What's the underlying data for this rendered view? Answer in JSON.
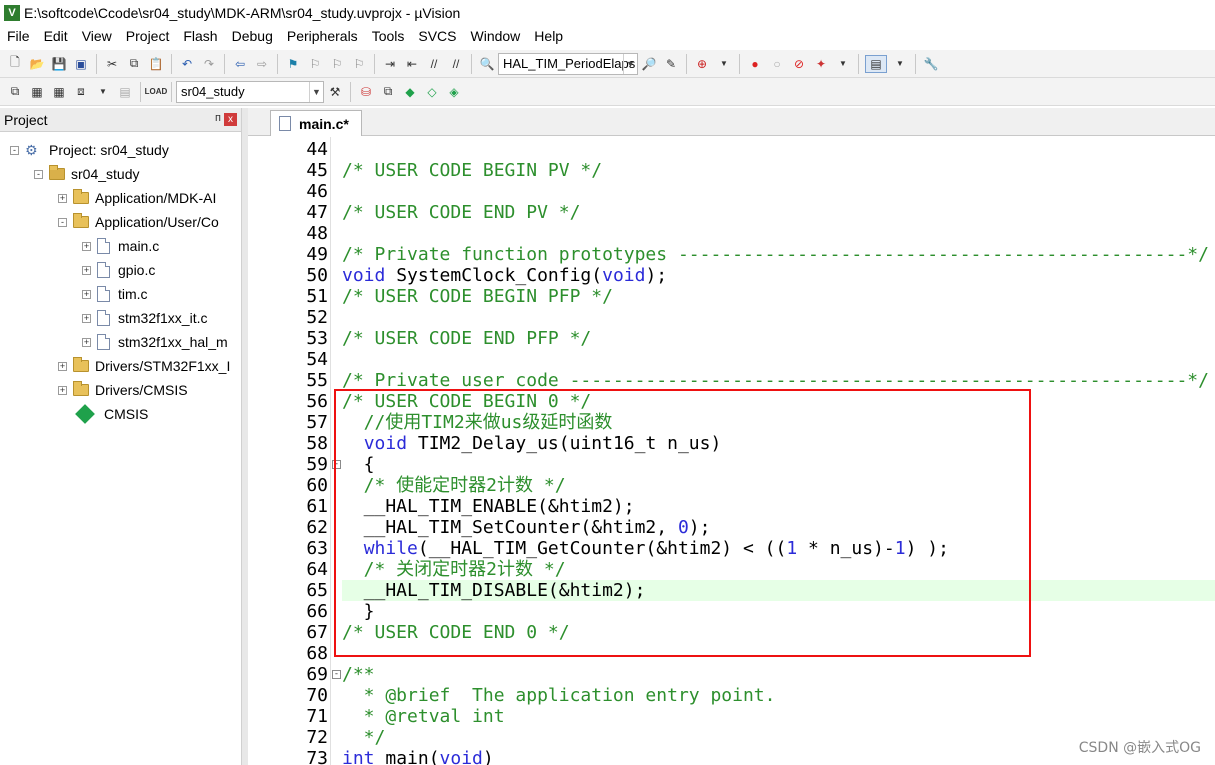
{
  "window": {
    "title": "E:\\softcode\\Ccode\\sr04_study\\MDK-ARM\\sr04_study.uvprojx - µVision",
    "app_icon_letter": "V"
  },
  "menu": [
    "File",
    "Edit",
    "View",
    "Project",
    "Flash",
    "Debug",
    "Peripherals",
    "Tools",
    "SVCS",
    "Window",
    "Help"
  ],
  "toolbar": {
    "function_combo": "HAL_TIM_PeriodElaps",
    "target_combo": "sr04_study"
  },
  "project_pane": {
    "title": "Project",
    "pin_glyph": "ᴨ",
    "close_glyph": "x",
    "tree": [
      {
        "label": "Project: sr04_study",
        "kind": "project",
        "expander": "-"
      },
      {
        "label": "sr04_study",
        "kind": "target",
        "expander": "-"
      },
      {
        "label": "Application/MDK-AI",
        "kind": "folder",
        "expander": "+"
      },
      {
        "label": "Application/User/Co",
        "kind": "folder",
        "expander": "-"
      },
      {
        "label": "main.c",
        "kind": "file",
        "expander": "+"
      },
      {
        "label": "gpio.c",
        "kind": "file",
        "expander": "+"
      },
      {
        "label": "tim.c",
        "kind": "file",
        "expander": "+"
      },
      {
        "label": "stm32f1xx_it.c",
        "kind": "file",
        "expander": "+"
      },
      {
        "label": "stm32f1xx_hal_m",
        "kind": "file",
        "expander": "+"
      },
      {
        "label": "Drivers/STM32F1xx_I",
        "kind": "folder",
        "expander": "+"
      },
      {
        "label": "Drivers/CMSIS",
        "kind": "folder",
        "expander": "+"
      },
      {
        "label": "CMSIS",
        "kind": "component",
        "expander": ""
      }
    ]
  },
  "editor": {
    "tab_label": "main.c*",
    "lines": [
      {
        "n": "44",
        "segs": []
      },
      {
        "n": "45",
        "segs": [
          {
            "t": "/* USER CODE BEGIN PV */",
            "c": "comment"
          }
        ]
      },
      {
        "n": "46",
        "segs": []
      },
      {
        "n": "47",
        "segs": [
          {
            "t": "/* USER CODE END PV */",
            "c": "comment"
          }
        ]
      },
      {
        "n": "48",
        "segs": []
      },
      {
        "n": "49",
        "segs": [
          {
            "t": "/* Private function prototypes -----------------------------------------------*/",
            "c": "comment"
          }
        ]
      },
      {
        "n": "50",
        "segs": [
          {
            "t": "void",
            "c": "kw"
          },
          {
            "t": " SystemClock_Config(",
            "c": "plain"
          },
          {
            "t": "void",
            "c": "kw"
          },
          {
            "t": ");",
            "c": "plain"
          }
        ]
      },
      {
        "n": "51",
        "segs": [
          {
            "t": "/* USER CODE BEGIN PFP */",
            "c": "comment"
          }
        ]
      },
      {
        "n": "52",
        "segs": []
      },
      {
        "n": "53",
        "segs": [
          {
            "t": "/* USER CODE END PFP */",
            "c": "comment"
          }
        ]
      },
      {
        "n": "54",
        "segs": []
      },
      {
        "n": "55",
        "segs": [
          {
            "t": "/* Private user code ---------------------------------------------------------*/",
            "c": "comment"
          }
        ]
      },
      {
        "n": "56",
        "segs": [
          {
            "t": "/* USER CODE BEGIN 0 */",
            "c": "comment"
          }
        ]
      },
      {
        "n": "57",
        "segs": [
          {
            "t": "  //使用TIM2来做us级延时函数",
            "c": "comment"
          }
        ]
      },
      {
        "n": "58",
        "segs": [
          {
            "t": "  ",
            "c": "plain"
          },
          {
            "t": "void",
            "c": "kw"
          },
          {
            "t": " TIM2_Delay_us(uint16_t n_us)",
            "c": "plain"
          }
        ]
      },
      {
        "n": "59",
        "segs": [
          {
            "t": "  {",
            "c": "plain"
          }
        ],
        "fold": "-"
      },
      {
        "n": "60",
        "segs": [
          {
            "t": "  /* 使能定时器2计数 */",
            "c": "comment"
          }
        ]
      },
      {
        "n": "61",
        "segs": [
          {
            "t": "  __HAL_TIM_ENABLE(&htim2);",
            "c": "plain"
          }
        ]
      },
      {
        "n": "62",
        "segs": [
          {
            "t": "  __HAL_TIM_SetCounter(&htim2, ",
            "c": "plain"
          },
          {
            "t": "0",
            "c": "num"
          },
          {
            "t": ");",
            "c": "plain"
          }
        ]
      },
      {
        "n": "63",
        "segs": [
          {
            "t": "  ",
            "c": "plain"
          },
          {
            "t": "while",
            "c": "kw"
          },
          {
            "t": "(__HAL_TIM_GetCounter(&htim2) < ((",
            "c": "plain"
          },
          {
            "t": "1",
            "c": "num"
          },
          {
            "t": " * n_us)-",
            "c": "plain"
          },
          {
            "t": "1",
            "c": "num"
          },
          {
            "t": ") );",
            "c": "plain"
          }
        ]
      },
      {
        "n": "64",
        "segs": [
          {
            "t": "  /* 关闭定时器2计数 */",
            "c": "comment"
          }
        ]
      },
      {
        "n": "65",
        "segs": [
          {
            "t": "  __HAL_TIM_DISABLE(&htim2);",
            "c": "plain"
          }
        ],
        "highlight": true
      },
      {
        "n": "66",
        "segs": [
          {
            "t": "  }",
            "c": "plain"
          }
        ]
      },
      {
        "n": "67",
        "segs": [
          {
            "t": "/* USER CODE END 0 */",
            "c": "comment"
          }
        ]
      },
      {
        "n": "68",
        "segs": []
      },
      {
        "n": "69",
        "segs": [
          {
            "t": "/**",
            "c": "comment"
          }
        ],
        "fold": "-"
      },
      {
        "n": "70",
        "segs": [
          {
            "t": "  * @brief  The application entry point.",
            "c": "comment"
          }
        ]
      },
      {
        "n": "71",
        "segs": [
          {
            "t": "  * @retval int",
            "c": "comment"
          }
        ]
      },
      {
        "n": "72",
        "segs": [
          {
            "t": "  */",
            "c": "comment"
          }
        ]
      },
      {
        "n": "73",
        "segs": [
          {
            "t": "int",
            "c": "kw"
          },
          {
            "t": " main(",
            "c": "plain"
          },
          {
            "t": "void",
            "c": "kw"
          },
          {
            "t": ")",
            "c": "plain"
          }
        ]
      }
    ]
  },
  "watermark": "CSDN @嵌入式OG"
}
